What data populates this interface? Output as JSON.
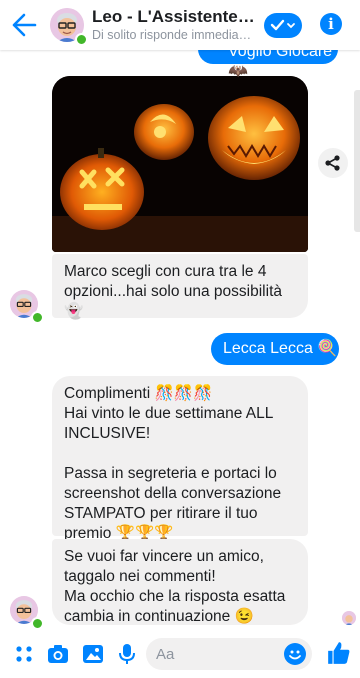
{
  "header": {
    "title": "Leo - L'Assistente Virt...",
    "subtitle": "Di solito risponde immediata..."
  },
  "messages": {
    "top_sent": "Voglio Giocare 🦇",
    "received_1": "Marco scegli con cura tra le 4 opzioni...hai solo una possibilità 👻",
    "sent_1": "Lecca Lecca 🍭",
    "received_2": "Complimenti 🎊🎊🎊\nHai vinto le due settimane ALL INCLUSIVE!\n\nPassa in segreteria e portaci lo screenshot della conversazione STAMPATO per ritirare il tuo premio 🏆🏆🏆",
    "received_3": "Se vuoi far vincere un amico, taggalo nei commenti!\nMa occhio che la risposta esatta cambia in continuazione 😉"
  },
  "composer": {
    "placeholder": "Aa"
  },
  "colors": {
    "accent": "#0084ff",
    "bubble": "#f1f0f0",
    "online": "#42b72a"
  },
  "icons": [
    "back-arrow-icon",
    "checkmark-icon",
    "info-icon",
    "share-icon",
    "apps-icon",
    "camera-icon",
    "gallery-icon",
    "microphone-icon",
    "emoji-icon",
    "like-icon"
  ]
}
